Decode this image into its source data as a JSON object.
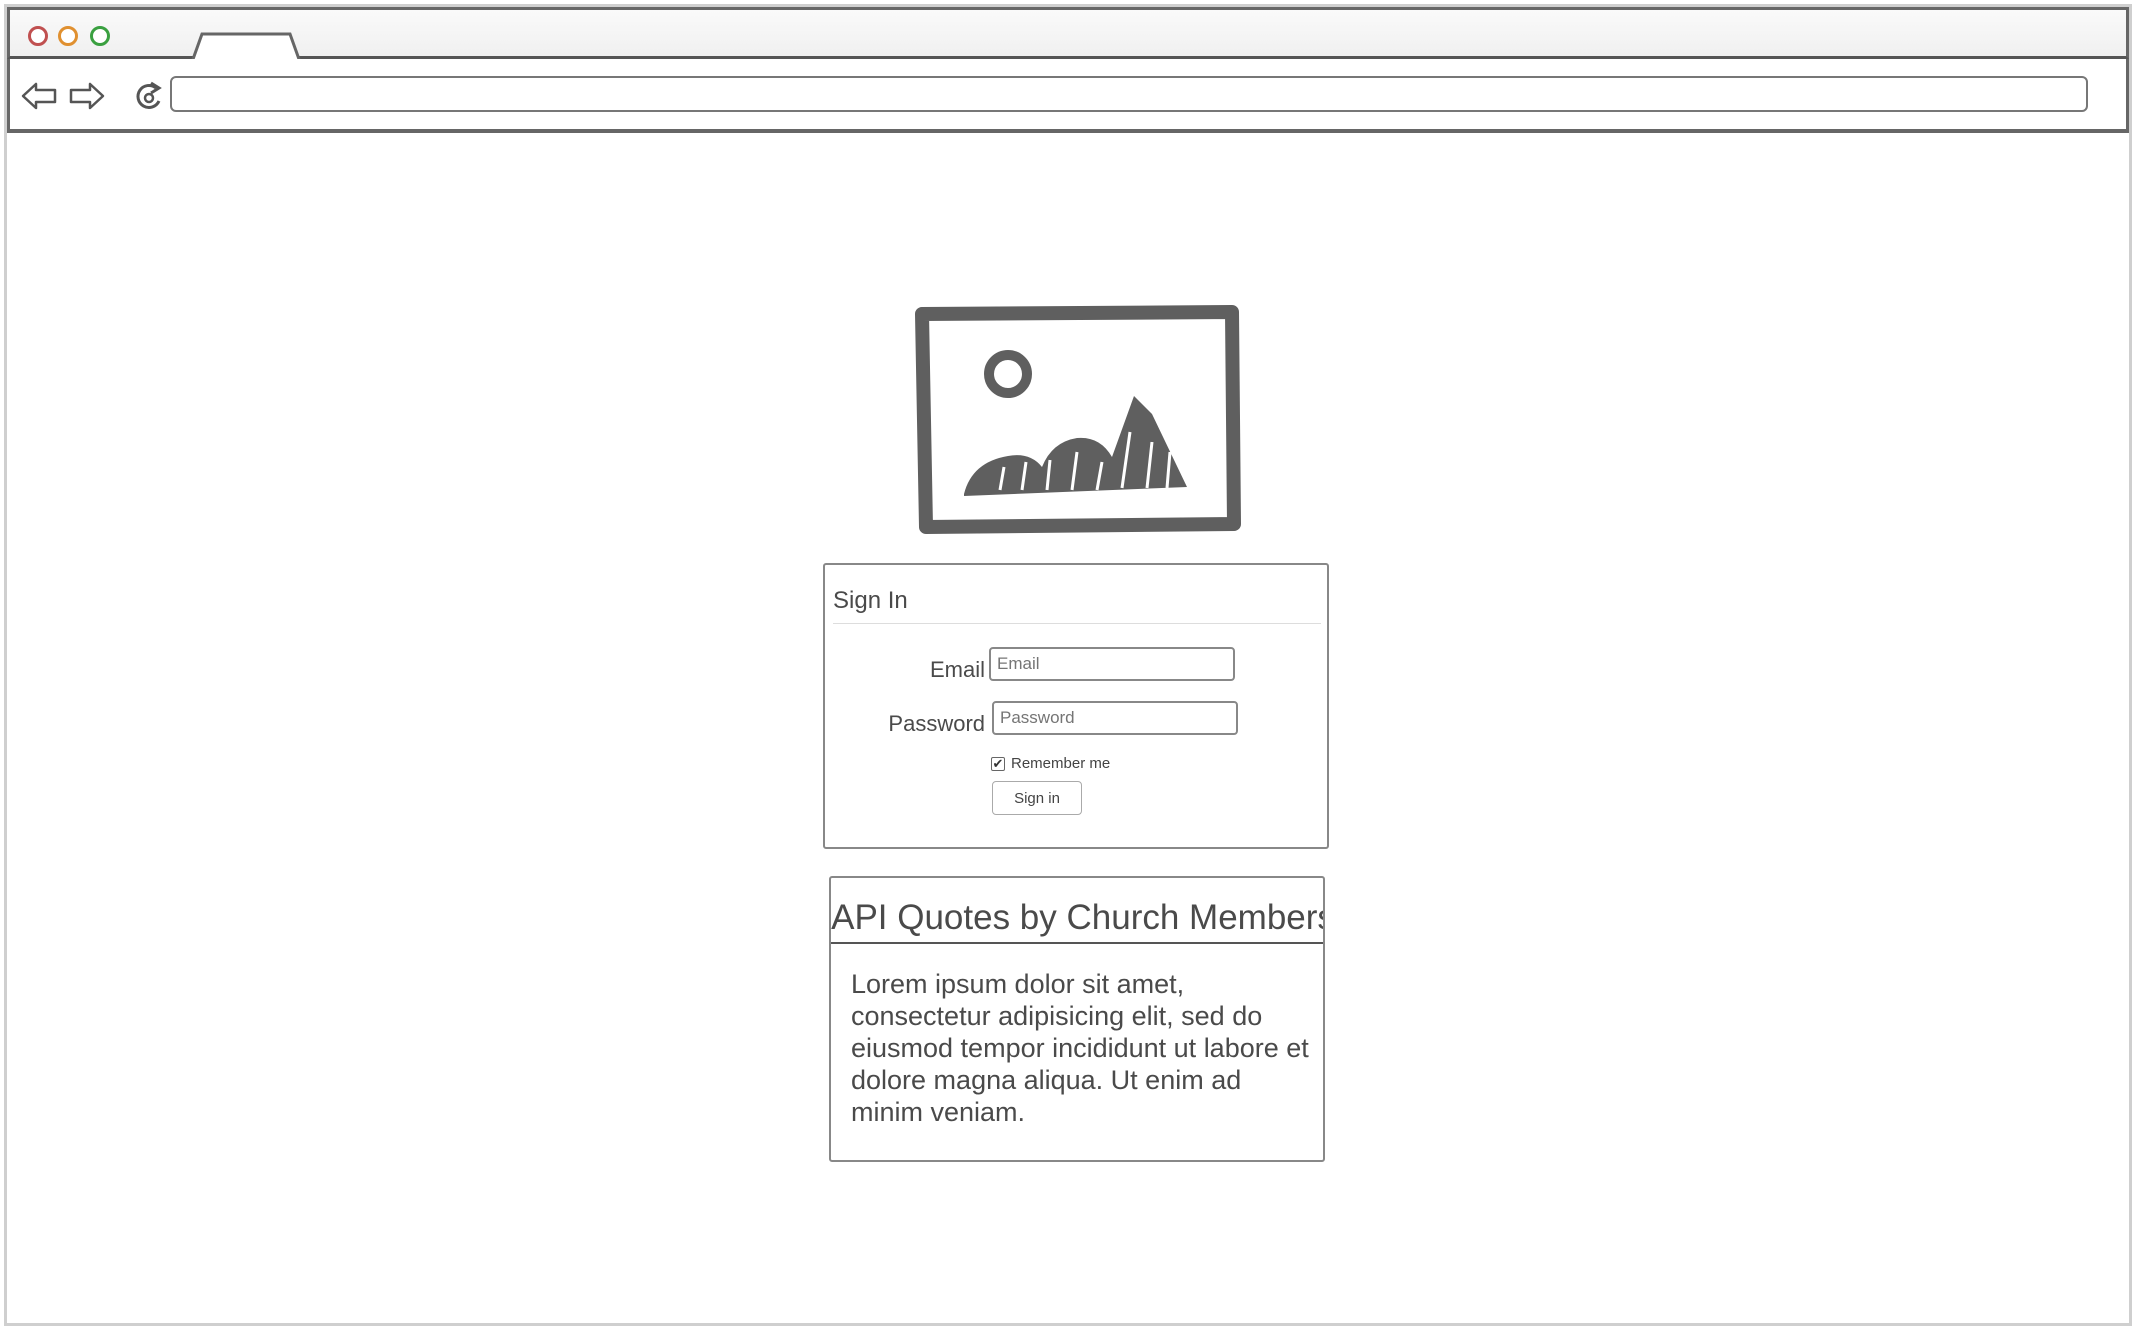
{
  "browser": {
    "url": ""
  },
  "signin": {
    "header": "Sign In",
    "email_label": "Email",
    "email_placeholder": "Email",
    "password_label": "Password",
    "password_placeholder": "Password",
    "remember_label": "Remember me",
    "remember_checked": true,
    "button_label": "Sign in"
  },
  "quote_panel": {
    "title": "API Quotes by Church Members",
    "body": "Lorem ipsum dolor sit amet, consectetur adipisicing elit, sed do eiusmod tempor incididunt ut labore et dolore magna aliqua. Ut enim ad minim veniam."
  },
  "colors": {
    "close": "#c05050",
    "minimize": "#e09030",
    "maximize": "#3aa040",
    "wireframe": "#5a5a5a"
  }
}
